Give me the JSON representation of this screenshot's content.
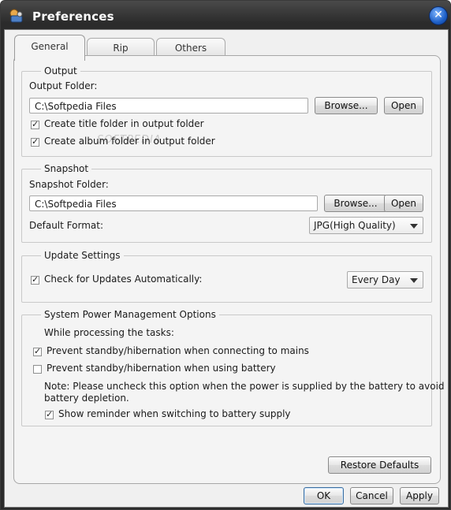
{
  "window": {
    "title": "Preferences",
    "close_glyph": "✕"
  },
  "tabs": [
    {
      "label": "General"
    },
    {
      "label": "Rip"
    },
    {
      "label": "Others"
    }
  ],
  "output": {
    "legend": "Output",
    "folder_label": "Output Folder:",
    "folder_value": "C:\\Softpedia Files",
    "browse_label": "Browse...",
    "open_label": "Open",
    "title_folder_label": "Create title folder in output folder",
    "title_folder_checked": true,
    "album_folder_label": "Create album folder in output folder",
    "album_folder_checked": true
  },
  "watermark": "SOFTPEDIA",
  "snapshot": {
    "legend": "Snapshot",
    "folder_label": "Snapshot Folder:",
    "folder_value": "C:\\Softpedia Files",
    "browse_label": "Browse...",
    "open_label": "Open",
    "format_label": "Default Format:",
    "format_value": "JPG(High Quality)"
  },
  "update": {
    "legend": "Update Settings",
    "check_label": "Check for Updates Automatically:",
    "check_checked": true,
    "frequency_value": "Every Day"
  },
  "power": {
    "legend": "System Power Management Options",
    "intro": "While processing the tasks:",
    "mains_label": "Prevent standby/hibernation when connecting to mains",
    "mains_checked": true,
    "battery_label": "Prevent standby/hibernation when using battery",
    "battery_checked": false,
    "note_line1": "Note: Please uncheck this option when the power is supplied by the battery to avoid",
    "note_line2": "battery depletion.",
    "reminder_label": "Show reminder when switching to battery supply",
    "reminder_checked": true
  },
  "footer": {
    "restore_label": "Restore Defaults",
    "ok_label": "OK",
    "cancel_label": "Cancel",
    "apply_label": "Apply"
  },
  "icons": {
    "app": "app-icon",
    "close": "close-icon",
    "dropdown": "chevron-down-icon",
    "checkbox": "checkmark-icon"
  }
}
